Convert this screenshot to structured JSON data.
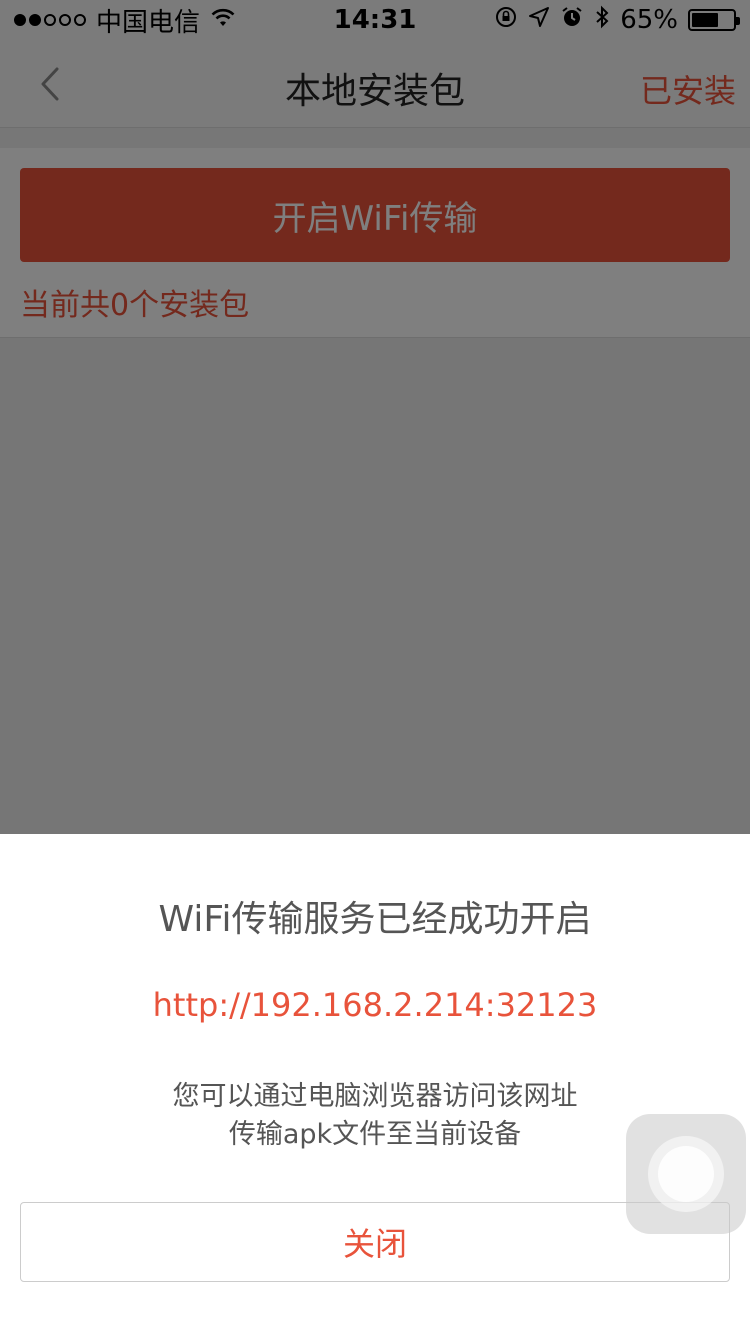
{
  "status_bar": {
    "carrier": "中国电信",
    "time": "14:31",
    "battery": "65%",
    "battery_level": 0.65,
    "signal_bars": 2,
    "signal_total": 5
  },
  "nav": {
    "title": "本地安装包",
    "right_label": "已安装",
    "back_icon": "chevron-left-icon"
  },
  "content": {
    "wifi_button_label": "开启WiFi传输",
    "package_count_text": "当前共0个安装包"
  },
  "sheet": {
    "title": "WiFi传输服务已经成功开启",
    "url": "http://192.168.2.214:32123",
    "desc_line1": "您可以通过电脑浏览器访问该网址",
    "desc_line2": "传输apk文件至当前设备",
    "close_label": "关闭"
  },
  "colors": {
    "accent": "#e8533b",
    "overlay": "rgba(0,0,0,0.5)"
  }
}
